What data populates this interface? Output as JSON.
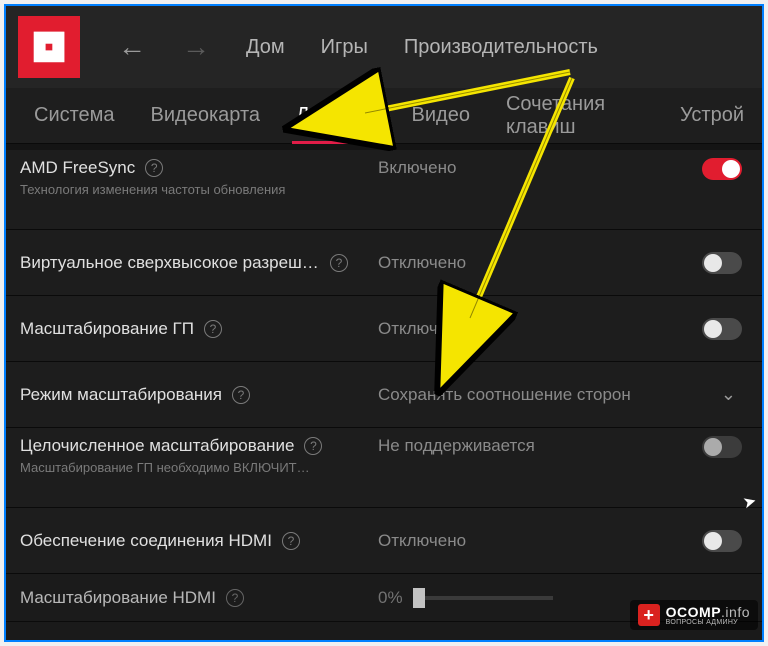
{
  "header": {
    "nav_home": "Дом",
    "nav_games": "Игры",
    "nav_perf": "Производительность"
  },
  "tabs": {
    "system": "Система",
    "gpu": "Видеокарта",
    "display": "Дисплей",
    "video": "Видео",
    "hotkeys": "Сочетания клавиш",
    "devices": "Устрой"
  },
  "rows": {
    "freesync": {
      "title": "AMD FreeSync",
      "sub": "Технология изменения частоты обновления",
      "value": "Включено"
    },
    "vsr": {
      "title": "Виртуальное сверхвысокое разреше…",
      "value": "Отключено"
    },
    "gpu_scaling": {
      "title": "Масштабирование ГП",
      "value": "Отключено"
    },
    "scaling_mode": {
      "title": "Режим масштабирования",
      "value": "Сохранять соотношение сторон"
    },
    "integer": {
      "title": "Целочисленное масштабирование",
      "sub": "Масштабирование ГП необходимо ВКЛЮЧИТ…",
      "value": "Не поддерживается"
    },
    "hdmi_link": {
      "title": "Обеспечение соединения HDMI",
      "value": "Отключено"
    },
    "hdmi_scale": {
      "title": "Масштабирование HDMI",
      "value": "0%"
    }
  },
  "badge": {
    "main": "OCOMP",
    "suffix": ".info",
    "sub": "ВОПРОСЫ АДМИНУ"
  }
}
